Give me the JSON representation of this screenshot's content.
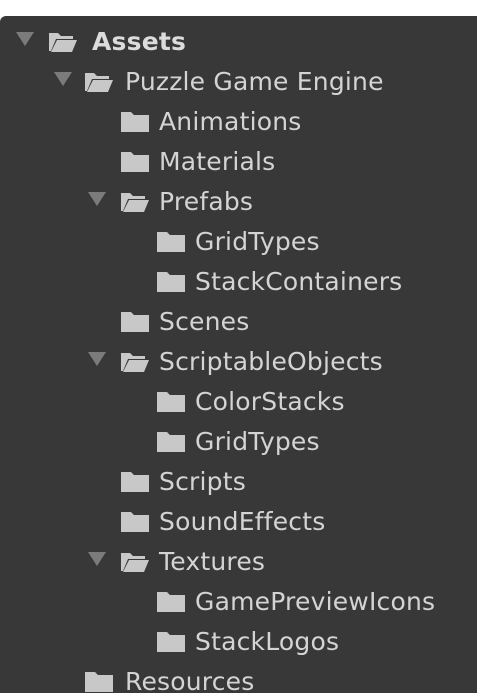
{
  "project_tree": {
    "items": [
      {
        "label": "Assets",
        "expanded": true,
        "depth": 0
      },
      {
        "label": "Puzzle Game Engine",
        "expanded": true,
        "depth": 1
      },
      {
        "label": "Animations",
        "expanded": false,
        "depth": 2
      },
      {
        "label": "Materials",
        "expanded": false,
        "depth": 2
      },
      {
        "label": "Prefabs",
        "expanded": true,
        "depth": 2
      },
      {
        "label": "GridTypes",
        "expanded": false,
        "depth": 3
      },
      {
        "label": "StackContainers",
        "expanded": false,
        "depth": 3
      },
      {
        "label": "Scenes",
        "expanded": false,
        "depth": 2
      },
      {
        "label": "ScriptableObjects",
        "expanded": true,
        "depth": 2
      },
      {
        "label": "ColorStacks",
        "expanded": false,
        "depth": 3
      },
      {
        "label": "GridTypes",
        "expanded": false,
        "depth": 3
      },
      {
        "label": "Scripts",
        "expanded": false,
        "depth": 2
      },
      {
        "label": "SoundEffects",
        "expanded": false,
        "depth": 2
      },
      {
        "label": "Textures",
        "expanded": true,
        "depth": 2
      },
      {
        "label": "GamePreviewIcons",
        "expanded": false,
        "depth": 3
      },
      {
        "label": "StackLogos",
        "expanded": false,
        "depth": 3
      },
      {
        "label": "Resources",
        "expanded": false,
        "depth": 1
      }
    ]
  },
  "colors": {
    "background": "#383838",
    "text": "#d4d4d4",
    "folder": "#c8c8c8",
    "arrow": "#7b7b7b"
  }
}
